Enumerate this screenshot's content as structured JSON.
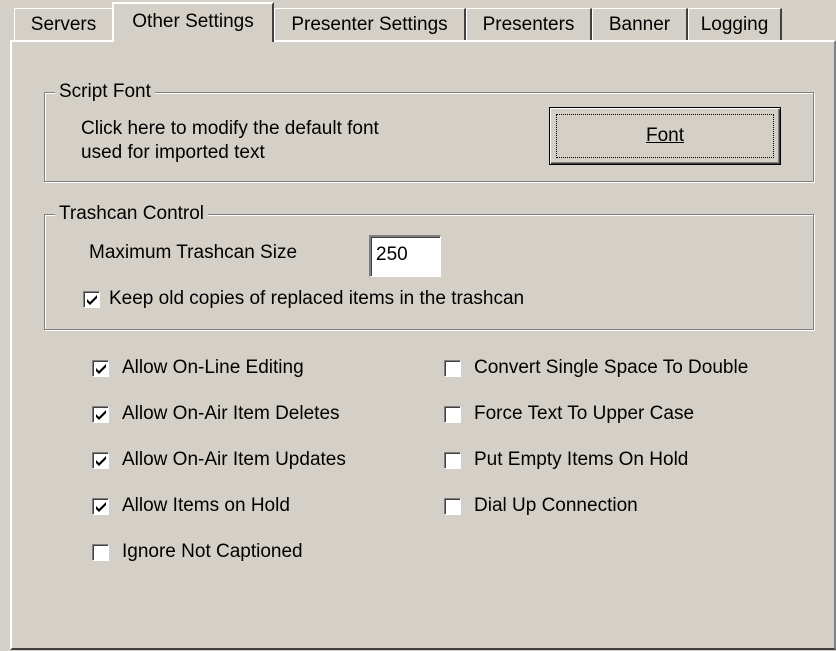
{
  "tabs": [
    {
      "label": "Servers",
      "active": false
    },
    {
      "label": "Other Settings",
      "active": true
    },
    {
      "label": "Presenter Settings",
      "active": false
    },
    {
      "label": "Presenters",
      "active": false
    },
    {
      "label": "Banner",
      "active": false
    },
    {
      "label": "Logging",
      "active": false
    }
  ],
  "script_font": {
    "title": "Script Font",
    "description_line1": "Click here to modify the default font",
    "description_line2": "used for imported text",
    "button_label": "Font"
  },
  "trashcan": {
    "title": "Trashcan Control",
    "size_label": "Maximum Trashcan Size",
    "size_value": "250",
    "keep_copies_label": "Keep old copies of replaced items in the trashcan",
    "keep_copies_checked": true
  },
  "options_left": [
    {
      "label": "Allow On-Line Editing",
      "checked": true
    },
    {
      "label": "Allow On-Air Item Deletes",
      "checked": true
    },
    {
      "label": "Allow On-Air Item Updates",
      "checked": true
    },
    {
      "label": "Allow Items on Hold",
      "checked": true
    },
    {
      "label": "Ignore Not Captioned",
      "checked": false
    }
  ],
  "options_right": [
    {
      "label": "Convert Single Space To Double",
      "checked": false
    },
    {
      "label": "Force Text To Upper Case",
      "checked": false
    },
    {
      "label": "Put Empty Items On Hold",
      "checked": false
    },
    {
      "label": "Dial Up Connection",
      "checked": false
    }
  ]
}
